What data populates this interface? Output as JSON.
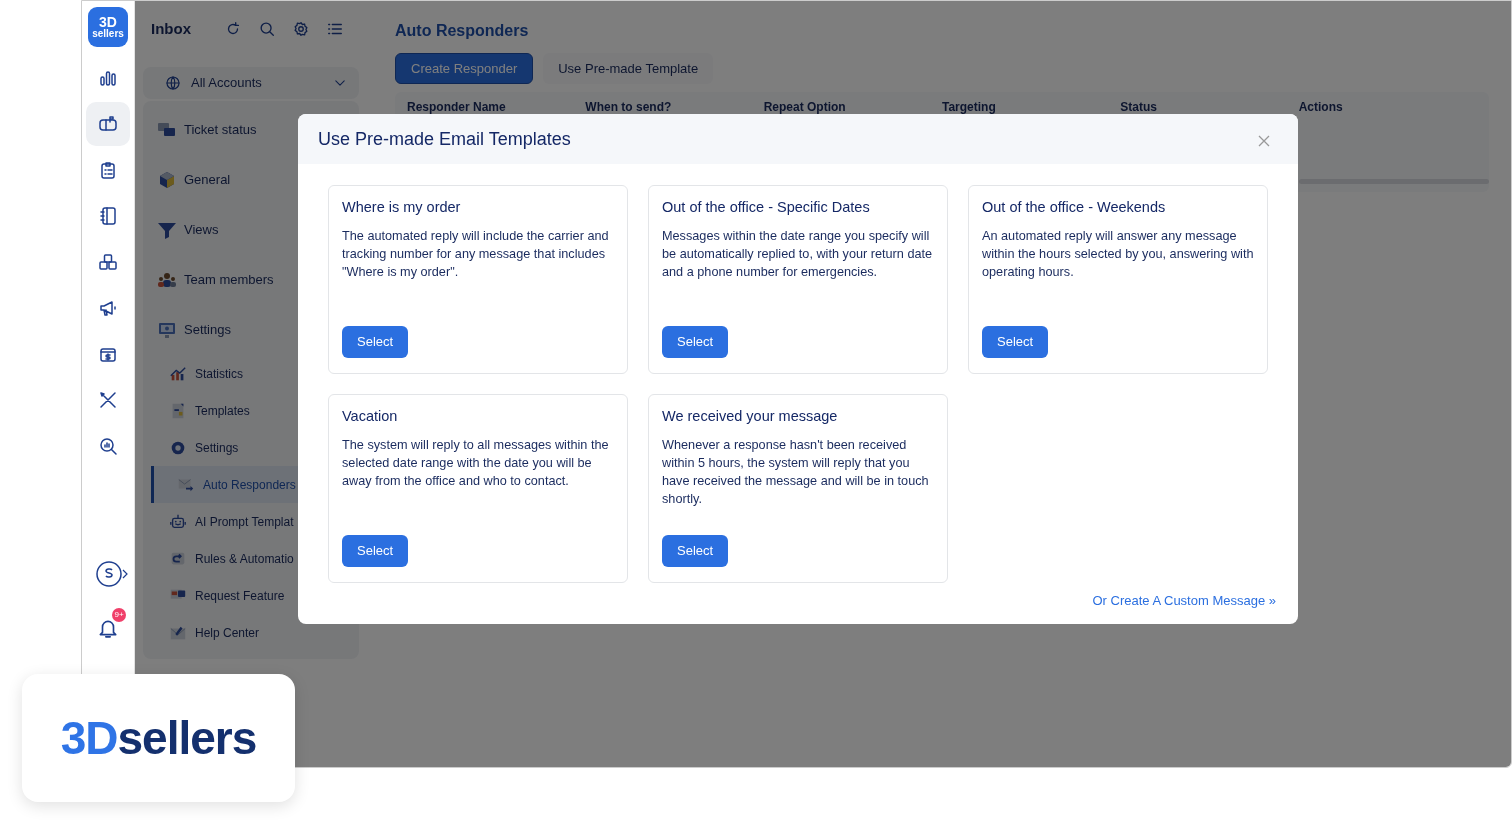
{
  "rail": {
    "logo": [
      "3D",
      "sellers"
    ],
    "items": [
      {
        "selected": false
      },
      {
        "selected": true
      },
      {
        "selected": false
      },
      {
        "selected": false
      },
      {
        "selected": false
      },
      {
        "selected": false
      },
      {
        "selected": false
      },
      {
        "selected": false
      },
      {
        "selected": false
      }
    ],
    "notifications": {
      "badge": "9+"
    }
  },
  "inbox": {
    "title": "Inbox",
    "account_select": {
      "value": "All Accounts"
    },
    "nav": [
      {
        "label": "Ticket status",
        "selected": false
      },
      {
        "label": "General",
        "selected": false
      },
      {
        "label": "Views",
        "selected": false
      },
      {
        "label": "Team members",
        "selected": false
      },
      {
        "label": "Settings",
        "selected": false,
        "children": [
          {
            "label": "Statistics",
            "selected": false
          },
          {
            "label": "Templates",
            "selected": false
          },
          {
            "label": "Settings",
            "selected": false
          },
          {
            "label": "Auto Responders",
            "selected": true
          },
          {
            "label": "AI Prompt Templat",
            "selected": false
          },
          {
            "label": "Rules & Automatio",
            "selected": false
          },
          {
            "label": "Request Feature",
            "selected": false
          },
          {
            "label": "Help Center",
            "selected": false
          }
        ]
      }
    ]
  },
  "page": {
    "title": "Auto Responders",
    "buttons": [
      {
        "label": "Create Responder",
        "kind": "primary"
      },
      {
        "label": "Use Pre-made Template",
        "kind": "secondary"
      }
    ],
    "table": {
      "columns": [
        "Responder Name",
        "When to send?",
        "Repeat Option",
        "Targeting",
        "Status",
        "Actions"
      ]
    }
  },
  "modal": {
    "title": "Use Pre-made Email Templates",
    "templates": [
      {
        "title": "Where is my order",
        "description": "The automated reply will include the carrier and tracking number for any message that includes \"Where is my order\".",
        "button": "Select"
      },
      {
        "title": "Out of the office - Specific Dates",
        "description": "Messages within the date range you specify will be automatically replied to, with your return date and a phone number for emergencies.",
        "button": "Select"
      },
      {
        "title": "Out of the office - Weekends",
        "description": "An automated reply will answer any message within the hours selected by you, answering with operating hours.",
        "button": "Select"
      },
      {
        "title": "Vacation",
        "description": "The system will reply to all messages within the selected date range with the date you will be away from the office and who to contact.",
        "button": "Select"
      },
      {
        "title": "We received your message",
        "description": "Whenever a response hasn't been received within 5 hours, the system will reply that you have received the message and will be in touch shortly.",
        "button": "Select"
      }
    ],
    "footer_link": "Or Create A Custom Message »"
  },
  "brand": {
    "logo": [
      "3D",
      "sellers"
    ]
  }
}
